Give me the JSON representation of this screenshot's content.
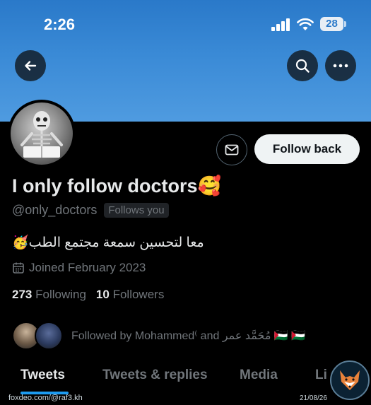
{
  "status_bar": {
    "time": "2:26",
    "battery": "28"
  },
  "profile": {
    "display_name": "I only follow doctors🥰",
    "handle": "@only_doctors",
    "follows_you_label": "Follows you",
    "bio": "معا لتحسين سمعة مجتمع الطب🥳",
    "joined": "Joined February 2023",
    "following_count": "273",
    "following_label": "Following",
    "followers_count": "10",
    "followers_label": "Followers",
    "followed_by": "Followed by Mohammed⁽ and مُحَمَّد عمر 🇵🇸 🇵🇸"
  },
  "actions": {
    "follow_back_label": "Follow back"
  },
  "tabs": [
    {
      "label": "Tweets"
    },
    {
      "label": "Tweets & replies"
    },
    {
      "label": "Media"
    },
    {
      "label": "Li"
    }
  ],
  "watermark": {
    "source": "foxdeo.com/@raf3.kh",
    "date": "21/08/26"
  },
  "colors": {
    "accent": "#1d9bf0",
    "banner": "#3a8ad6",
    "background": "#000000",
    "muted": "#71767b"
  }
}
